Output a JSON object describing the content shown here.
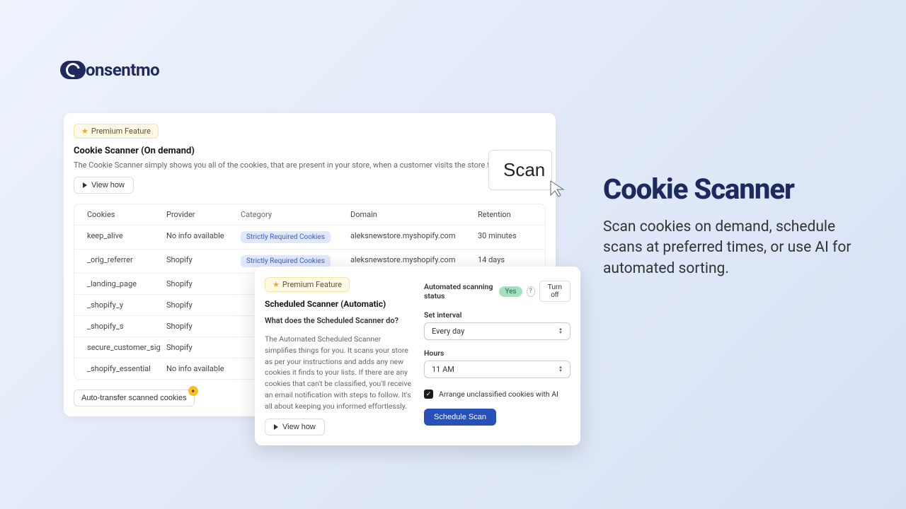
{
  "logo": "onsentmo",
  "main": {
    "premium": "Premium Feature",
    "title": "Cookie Scanner (On demand)",
    "desc": "The Cookie Scanner simply shows you all of the cookies, that are present in your store, when a customer visits the store for the first time.",
    "view_how": "View how",
    "scan": "Scan",
    "auto_transfer": "Auto-transfer scanned cookies"
  },
  "table": {
    "headers": {
      "cookies": "Cookies",
      "provider": "Provider",
      "category": "Category",
      "domain": "Domain",
      "retention": "Retention"
    },
    "rows": [
      {
        "cookie": "keep_alive",
        "provider": "No info available",
        "category": "Strictly Required Cookies",
        "domain": "aleksnewstore.myshopify.com",
        "retention": "30 minutes"
      },
      {
        "cookie": "_orig_referrer",
        "provider": "Shopify",
        "category": "Strictly Required Cookies",
        "domain": "aleksnewstore.myshopify.com",
        "retention": "14 days"
      },
      {
        "cookie": "_landing_page",
        "provider": "Shopify",
        "category": "",
        "domain": "",
        "retention": ""
      },
      {
        "cookie": "_shopify_y",
        "provider": "Shopify",
        "category": "",
        "domain": "",
        "retention": ""
      },
      {
        "cookie": "_shopify_s",
        "provider": "Shopify",
        "category": "",
        "domain": "",
        "retention": ""
      },
      {
        "cookie": "secure_customer_sig",
        "provider": "Shopify",
        "category": "",
        "domain": "",
        "retention": ""
      },
      {
        "cookie": "_shopify_essential",
        "provider": "No info available",
        "category": "",
        "domain": "",
        "retention": ""
      }
    ]
  },
  "scheduled": {
    "premium": "Premium Feature",
    "title": "Scheduled Scanner (Automatic)",
    "subtitle": "What does the Scheduled Scanner do?",
    "desc": "The Automated Scheduled Scanner simplifies things for you. It scans your store as per your instructions and adds any new cookies it finds to your lists. If there are any cookies that can't be classified, you'll receive an email notification with steps to follow. It's all about keeping you informed effortlessly.",
    "view_how": "View how",
    "status_label": "Automated scanning status",
    "status_value": "Yes",
    "turn_off": "Turn off",
    "interval_label": "Set interval",
    "interval_value": "Every day",
    "hours_label": "Hours",
    "hours_value": "11 AM",
    "ai_checkbox": "Arrange unclassified cookies with AI",
    "schedule_btn": "Schedule Scan"
  },
  "marketing": {
    "title": "Cookie Scanner",
    "desc": "Scan cookies on demand, schedule scans at preferred times, or use AI for automated sorting."
  }
}
